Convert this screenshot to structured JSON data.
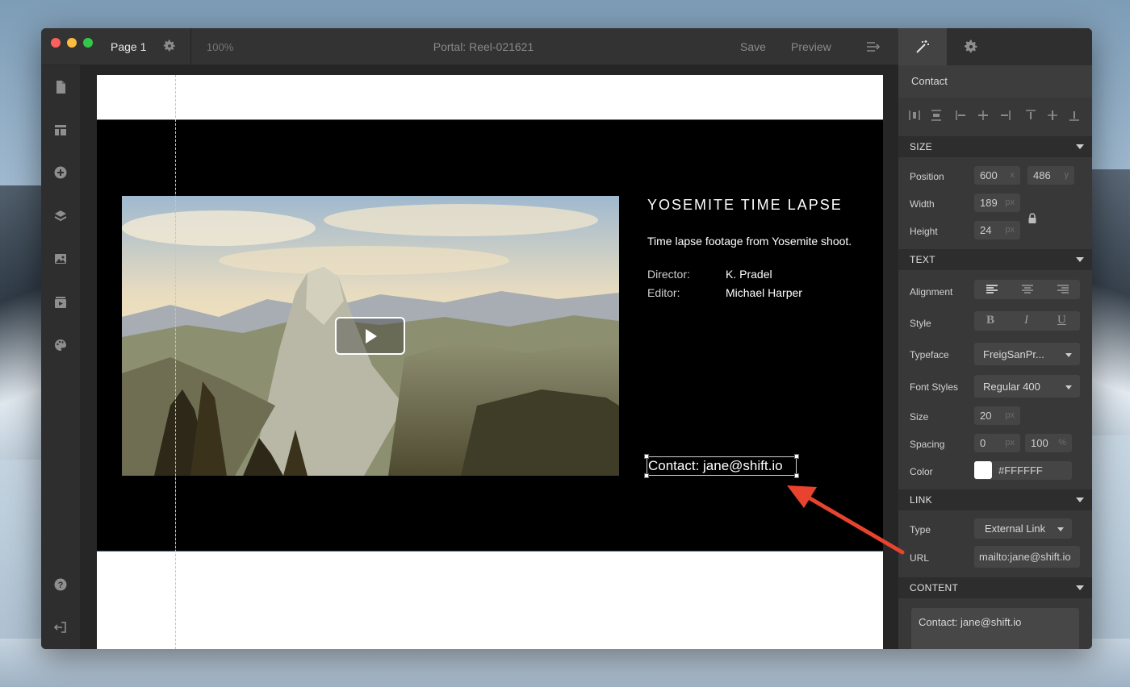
{
  "window": {
    "page_name": "Page 1",
    "zoom": "100%",
    "title": "Portal: Reel-021621",
    "save_label": "Save",
    "preview_label": "Preview"
  },
  "left_toolbar": {
    "items": [
      "page-icon",
      "layout-icon",
      "add-icon",
      "layers-icon",
      "image-icon",
      "media-icon",
      "palette-icon",
      "help-icon",
      "exit-icon"
    ]
  },
  "canvas": {
    "video_title": "YOSEMITE TIME LAPSE",
    "video_description": "Time lapse footage from Yosemite shoot.",
    "credits": [
      {
        "label": "Director:",
        "value": "K. Pradel"
      },
      {
        "label": "Editor:",
        "value": "Michael Harper"
      }
    ],
    "contact_text": "Contact: jane@shift.io"
  },
  "panel": {
    "element_name": "Contact",
    "size": {
      "heading": "SIZE",
      "position_label": "Position",
      "position_x": "600",
      "position_x_unit": "x",
      "position_y": "486",
      "position_y_unit": "y",
      "width_label": "Width",
      "width": "189",
      "width_unit": "px",
      "height_label": "Height",
      "height": "24",
      "height_unit": "px"
    },
    "text": {
      "heading": "TEXT",
      "alignment_label": "Alignment",
      "style_label": "Style",
      "style_bold": "B",
      "style_italic": "I",
      "style_underline": "U",
      "typeface_label": "Typeface",
      "typeface": "FreigSanPr...",
      "font_styles_label": "Font Styles",
      "font_style": "Regular 400",
      "size_label": "Size",
      "size": "20",
      "size_unit": "px",
      "spacing_label": "Spacing",
      "spacing_letter": "0",
      "spacing_letter_unit": "px",
      "spacing_line": "100",
      "spacing_line_unit": "%",
      "color_label": "Color",
      "color": "#FFFFFF"
    },
    "link": {
      "heading": "LINK",
      "type_label": "Type",
      "type": "External Link",
      "url_label": "URL",
      "url": "mailto:jane@shift.io"
    },
    "content": {
      "heading": "CONTENT",
      "value": "Contact: jane@shift.io"
    }
  },
  "colors": {
    "annotation_arrow": "#e8432e",
    "selection_outline": "#d0d0d0"
  }
}
